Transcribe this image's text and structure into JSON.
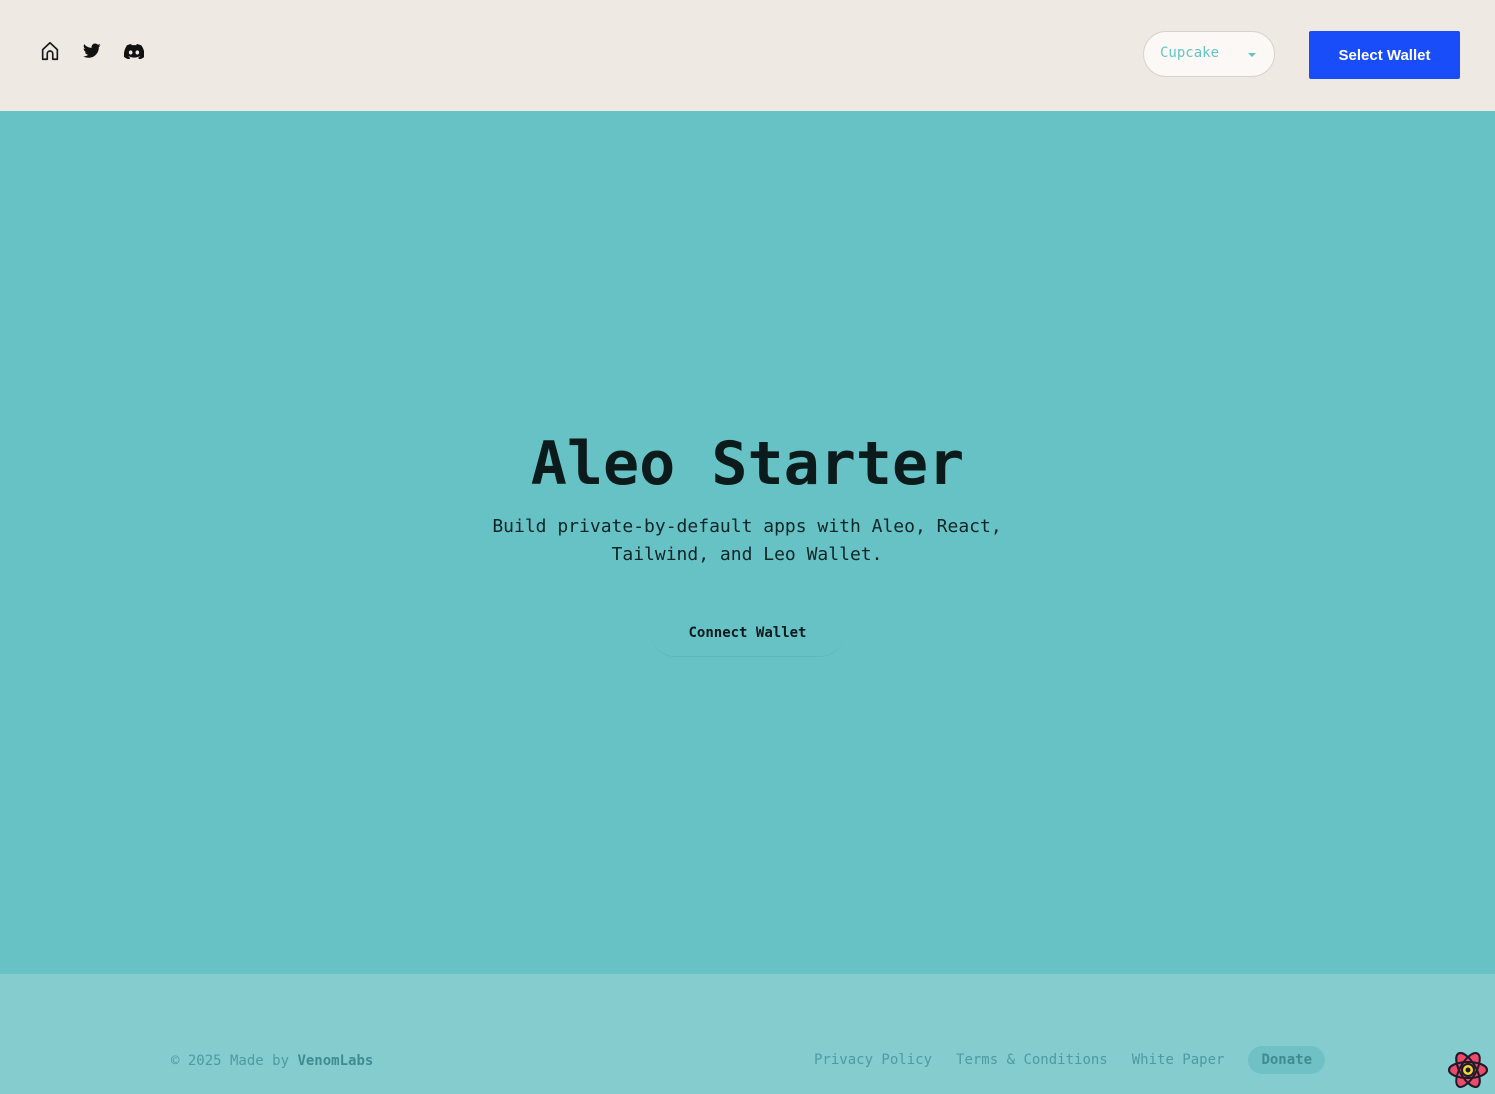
{
  "header": {
    "nav_icons": [
      "home-icon",
      "twitter-icon",
      "discord-icon"
    ],
    "theme_select": {
      "value": "Cupcake"
    },
    "select_wallet_label": "Select Wallet"
  },
  "hero": {
    "title": "Aleo Starter",
    "subtitle": "Build private-by-default apps with Aleo, React, Tailwind, and Leo Wallet.",
    "connect_label": "Connect Wallet"
  },
  "footer": {
    "copyright_prefix": "© 2025 Made by ",
    "brand": "VenomLabs",
    "links": [
      "Privacy Policy",
      "Terms & Conditions",
      "White Paper"
    ],
    "donate_label": "Donate"
  },
  "colors": {
    "header_bg": "#efe9e4",
    "hero_bg": "#67c2c6",
    "footer_bg": "#85cccf",
    "primary_button": "#1a4dfa",
    "accent": "#65c3c8"
  }
}
